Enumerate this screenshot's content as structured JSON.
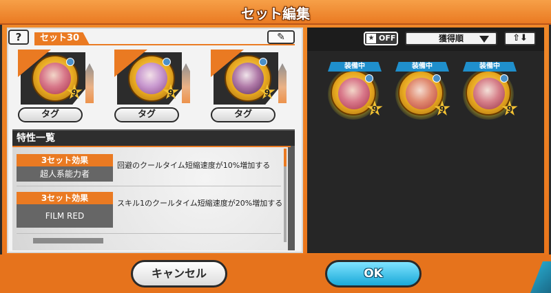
{
  "title": "セット編集",
  "left": {
    "help_label": "?",
    "set_label": "セット30",
    "edit_icon": "pencil-icon",
    "slots": [
      {
        "level": "9",
        "tag_label": "タグ"
      },
      {
        "level": "9",
        "tag_label": "タグ"
      },
      {
        "level": "9",
        "tag_label": "タグ"
      }
    ],
    "traits_title": "特性一覧",
    "traits": [
      {
        "badge": "3セット効果",
        "name": "超人系能力者",
        "desc": "回避のクールタイム短縮速度が10%増加する"
      },
      {
        "badge": "3セット効果",
        "name": "FILM RED",
        "desc": "スキル1のクールタイム短縮速度が20%増加する"
      }
    ]
  },
  "right": {
    "filter_off_label": "OFF",
    "sort_label": "獲得順",
    "order_label": "⇧⬇",
    "owned": [
      {
        "status": "装備中",
        "level": "9"
      },
      {
        "status": "装備中",
        "level": "9"
      },
      {
        "status": "装備中",
        "level": "9"
      }
    ]
  },
  "buttons": {
    "cancel": "キャンセル",
    "ok": "OK"
  },
  "colors": {
    "accent": "#ea7a22",
    "ok_blue": "#1aa9d8",
    "equip_blue": "#1f8fcc"
  }
}
